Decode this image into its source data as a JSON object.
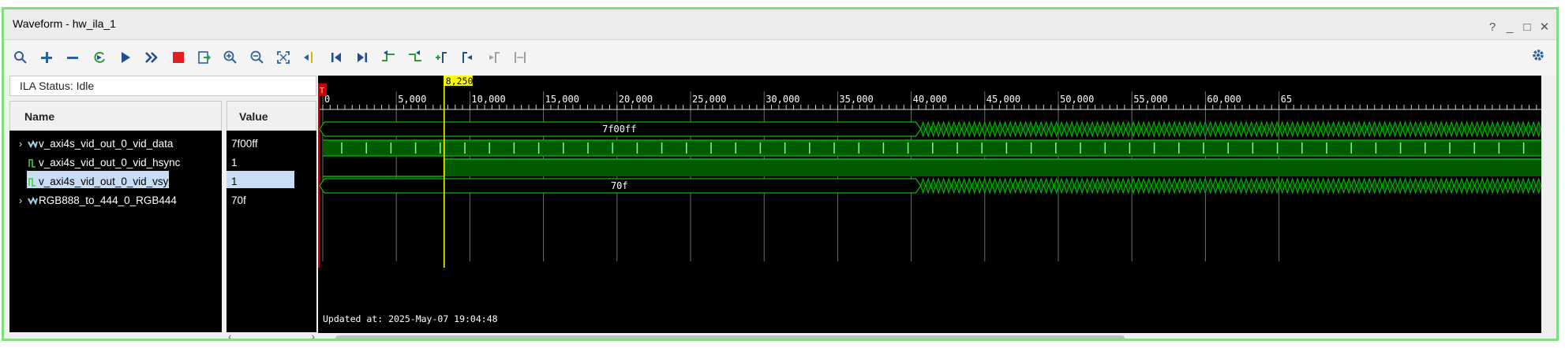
{
  "window": {
    "title": "Waveform - hw_ila_1",
    "controls": [
      "?",
      "_",
      "□",
      "✕"
    ]
  },
  "toolbar": {
    "buttons": [
      {
        "name": "search",
        "icon": "search-icon"
      },
      {
        "name": "add",
        "icon": "plus-icon"
      },
      {
        "name": "remove",
        "icon": "minus-icon"
      },
      {
        "name": "run-trigger-immediate",
        "icon": "refresh-run-icon"
      },
      {
        "name": "run",
        "icon": "play-icon"
      },
      {
        "name": "run-continuous",
        "icon": "double-chevron-icon"
      },
      {
        "name": "stop",
        "icon": "stop-icon"
      },
      {
        "name": "export",
        "icon": "export-icon"
      },
      {
        "name": "zoom-in",
        "icon": "zoom-in-icon"
      },
      {
        "name": "zoom-out",
        "icon": "zoom-out-icon"
      },
      {
        "name": "zoom-fit",
        "icon": "zoom-fit-icon"
      },
      {
        "name": "go-to-cursor",
        "icon": "cursor-icon"
      },
      {
        "name": "go-to-time-zero",
        "icon": "first-icon"
      },
      {
        "name": "go-to-last-time",
        "icon": "last-icon"
      },
      {
        "name": "previous-transition",
        "icon": "prev-transition-icon"
      },
      {
        "name": "next-transition",
        "icon": "next-transition-icon"
      },
      {
        "name": "add-marker",
        "icon": "add-marker-icon"
      },
      {
        "name": "previous-marker",
        "icon": "prev-marker-icon"
      },
      {
        "name": "next-marker",
        "icon": "next-marker-icon"
      },
      {
        "name": "swap-cursors",
        "icon": "swap-cursors-icon"
      }
    ]
  },
  "ila_status": "ILA Status: Idle",
  "columns": {
    "name": "Name",
    "value": "Value"
  },
  "signals": [
    {
      "name": "v_axi4s_vid_out_0_vid_data",
      "value": "7f00ff",
      "type": "bus",
      "expandable": true,
      "selected": false
    },
    {
      "name": "v_axi4s_vid_out_0_vid_hsync",
      "value": "1",
      "type": "bit",
      "expandable": false,
      "selected": false
    },
    {
      "name": "v_axi4s_vid_out_0_vid_vsync",
      "value": "1",
      "type": "bit",
      "expandable": false,
      "selected": true
    },
    {
      "name": "RGB888_to_444_0_RGB444",
      "value": "70f",
      "type": "bus",
      "expandable": true,
      "selected": false
    }
  ],
  "waveform": {
    "cursor_label": "8,250",
    "trigger_marker": "T",
    "time_ticks": [
      "0",
      "5,000",
      "10,000",
      "15,000",
      "20,000",
      "25,000",
      "30,000",
      "35,000",
      "40,000",
      "45,000",
      "50,000",
      "55,000",
      "60,000",
      "65"
    ],
    "bus_labels": [
      "7f00ff",
      "70f"
    ],
    "updated_text": "Updated at: 2025-May-07 19:04:48",
    "colors": {
      "background": "#000000",
      "signal": "#00c000",
      "cursor": "#ffff00",
      "grid": "#6e6e6e"
    }
  }
}
